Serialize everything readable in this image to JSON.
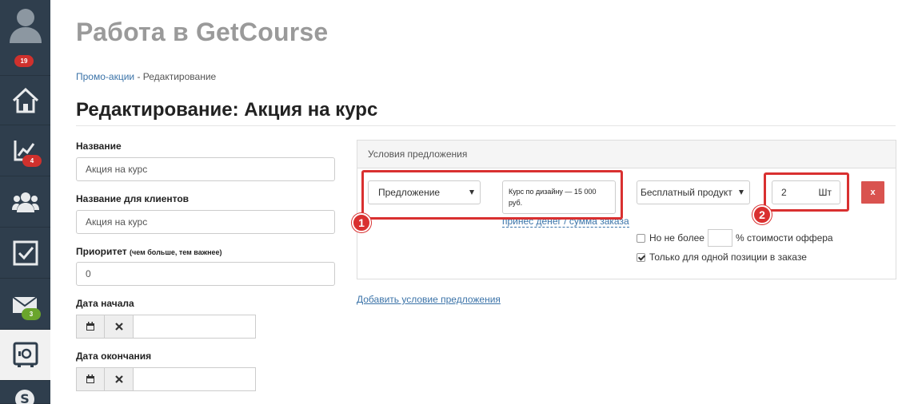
{
  "sidebar": {
    "badges": {
      "profile": "19",
      "analytics": "4",
      "messages": "3"
    }
  },
  "header": {
    "app_title": "Работа в GetCourse"
  },
  "breadcrumb": {
    "parent": "Промо-акции",
    "separator": " - ",
    "current": "Редактирование"
  },
  "page": {
    "heading": "Редактирование: Акция на курс"
  },
  "form": {
    "name_label": "Название",
    "name_value": "Акция на курс",
    "client_name_label": "Название для клиентов",
    "client_name_value": "Акция на курс",
    "priority_label": "Приоритет",
    "priority_hint": "(чем больше, тем важнее)",
    "priority_value": "0",
    "start_date_label": "Дата начала",
    "end_date_label": "Дата окончания"
  },
  "conditions": {
    "panel_title": "Условия предложения",
    "type_select": "Предложение",
    "offer_text": "Курс по дизайну — 15 000 руб.",
    "offer_link": "принес денег / сумма заказа",
    "benefit_select": "Бесплатный продукт",
    "quantity_value": "2",
    "quantity_unit": "Шт",
    "delete_label": "x",
    "limit_prefix": "Но не более",
    "limit_suffix": "% стоимости оффера",
    "single_position_label": "Только для одной позиции в заказе",
    "add_condition_label": "Добавить условие предложения"
  },
  "annotations": {
    "marker_1": "1",
    "marker_2": "2"
  },
  "colors": {
    "sidebar_bg": "#2f3e4d",
    "link": "#3b73a8",
    "annotation": "#d93030",
    "delete": "#d9534f"
  }
}
